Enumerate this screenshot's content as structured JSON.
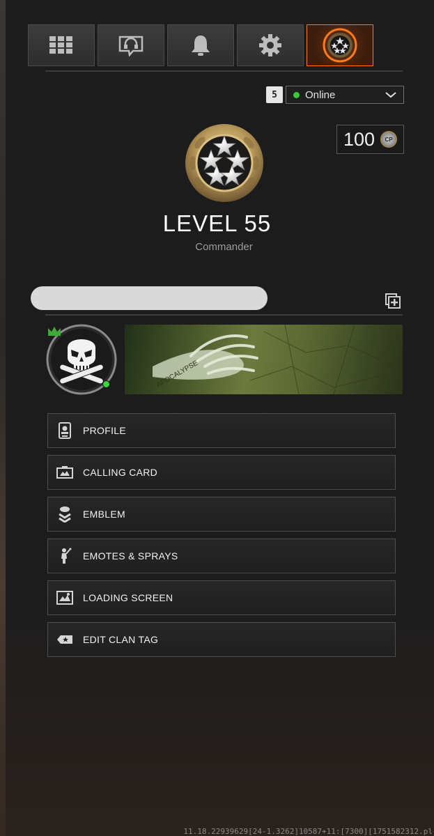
{
  "tabs": [
    {
      "name": "grid-icon"
    },
    {
      "name": "headset-icon"
    },
    {
      "name": "bell-icon"
    },
    {
      "name": "gear-icon"
    },
    {
      "name": "rank-star-icon",
      "active": true
    }
  ],
  "friends_count": "5",
  "status": {
    "label": "Online",
    "color": "#38c83a"
  },
  "cod_points": {
    "amount": "100",
    "icon": "cod-points-icon",
    "icon_text": "CP"
  },
  "player": {
    "level_text": "LEVEL 55",
    "rank_title": "Commander",
    "online": true
  },
  "menu": [
    {
      "label": "PROFILE",
      "icon": "profile-card-icon"
    },
    {
      "label": "CALLING CARD",
      "icon": "calling-card-icon"
    },
    {
      "label": "EMBLEM",
      "icon": "emblem-icon"
    },
    {
      "label": "EMOTES & SPRAYS",
      "icon": "emote-icon"
    },
    {
      "label": "LOADING SCREEN",
      "icon": "loading-screen-icon"
    },
    {
      "label": "EDIT CLAN TAG",
      "icon": "clan-tag-icon"
    }
  ],
  "calling_card_text": "APOCALYPSE",
  "build_string": "11.18.22939629[24-1.3262]10587+11:[7300][1751582312.pl"
}
